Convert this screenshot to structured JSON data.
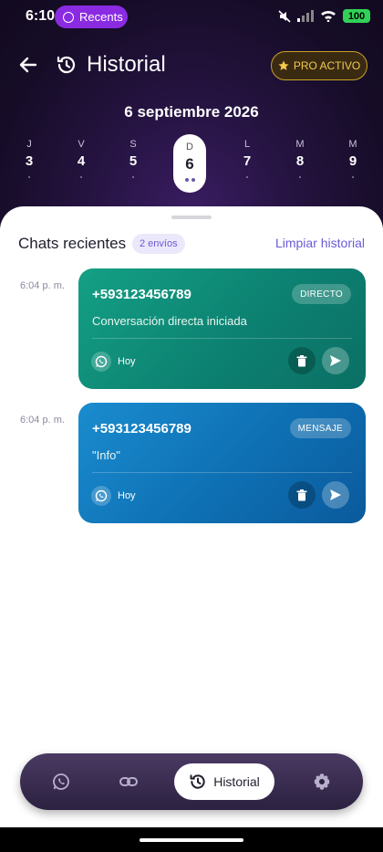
{
  "status_bar": {
    "time": "6:10",
    "recents_label": "Recents",
    "battery": "100"
  },
  "header": {
    "title": "Historial",
    "pro_label": "PRO ACTIVO",
    "date_label": "6 septiembre 2026"
  },
  "week": [
    {
      "letter": "J",
      "num": "3"
    },
    {
      "letter": "V",
      "num": "4"
    },
    {
      "letter": "S",
      "num": "5"
    },
    {
      "letter": "D",
      "num": "6",
      "active": true
    },
    {
      "letter": "L",
      "num": "7"
    },
    {
      "letter": "M",
      "num": "8"
    },
    {
      "letter": "M",
      "num": "9"
    }
  ],
  "sheet": {
    "title": "Chats recientes",
    "count_badge": "2 envíos",
    "clear_label": "Limpiar historial"
  },
  "chats": [
    {
      "time": "6:04 p. m.",
      "phone": "+593123456789",
      "tag": "DIRECTO",
      "message": "Conversación directa iniciada",
      "when": "Hoy",
      "color": "#14a085"
    },
    {
      "time": "6:04 p. m.",
      "phone": "+593123456789",
      "tag": "MENSAJE",
      "message": "\"Info\"",
      "when": "Hoy",
      "color": "#1a8ccf"
    }
  ],
  "nav": {
    "items": [
      {
        "icon": "whatsapp-icon"
      },
      {
        "icon": "link-icon"
      },
      {
        "icon": "history-icon",
        "label": "Historial",
        "active": true
      },
      {
        "icon": "gear-icon"
      }
    ]
  },
  "colors": {
    "accent": "#6a5bd6",
    "header_bg": "#1e1035",
    "pro_gold": "#f2c94c"
  }
}
